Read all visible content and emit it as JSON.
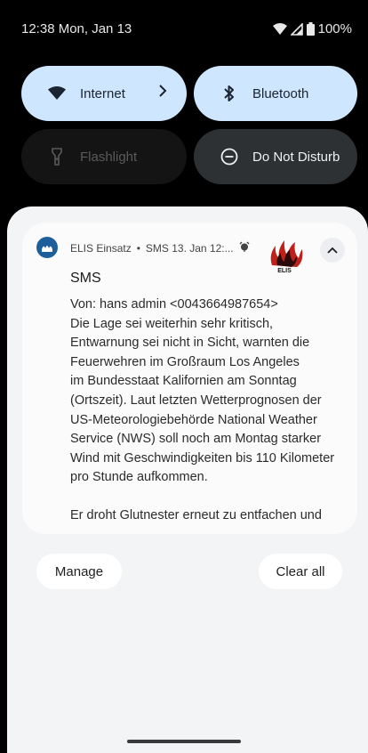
{
  "status_bar": {
    "time": "12:38 Mon, Jan 13",
    "battery": "100%"
  },
  "quick_settings": {
    "tiles": [
      {
        "label": "Internet",
        "icon": "wifi-icon",
        "state": "on"
      },
      {
        "label": "Bluetooth",
        "icon": "bluetooth-icon",
        "state": "on"
      },
      {
        "label": "Flashlight",
        "icon": "flashlight-icon",
        "state": "unavailable"
      },
      {
        "label": "Do Not Disturb",
        "icon": "do-not-disturb-icon",
        "state": "off"
      }
    ]
  },
  "notification": {
    "app_name": "ELIS Einsatz",
    "separator": "•",
    "subtext": "SMS 13. Jan 12:...",
    "title": "SMS",
    "body_lines": [
      "Von: hans admin <0043664987654>",
      "Die Lage sei weiterhin sehr kritisch,",
      "Entwarnung sei nicht in Sicht, warnten die",
      "Feuerwehren im Großraum Los Angeles",
      "im Bundesstaat Kalifornien am Sonntag",
      "(Ortszeit). Laut letzten Wetterprognosen der",
      "US-Meteorologiebehörde National Weather",
      "Service (NWS) soll noch am Montag starker",
      "Wind mit Geschwindigkeiten bis 110 Kilometer",
      "pro Stunde aufkommen."
    ],
    "body_continuation": "Er droht Glutnester erneut zu entfachen und",
    "logo_text": "ELIS",
    "accent_color": "#1d5f9a"
  },
  "actions": {
    "manage_label": "Manage",
    "clear_all_label": "Clear all"
  },
  "colors": {
    "tile_on": "#cfe6ff",
    "tile_off": "#2e3133",
    "shade_bg": "#f3f4f6"
  }
}
